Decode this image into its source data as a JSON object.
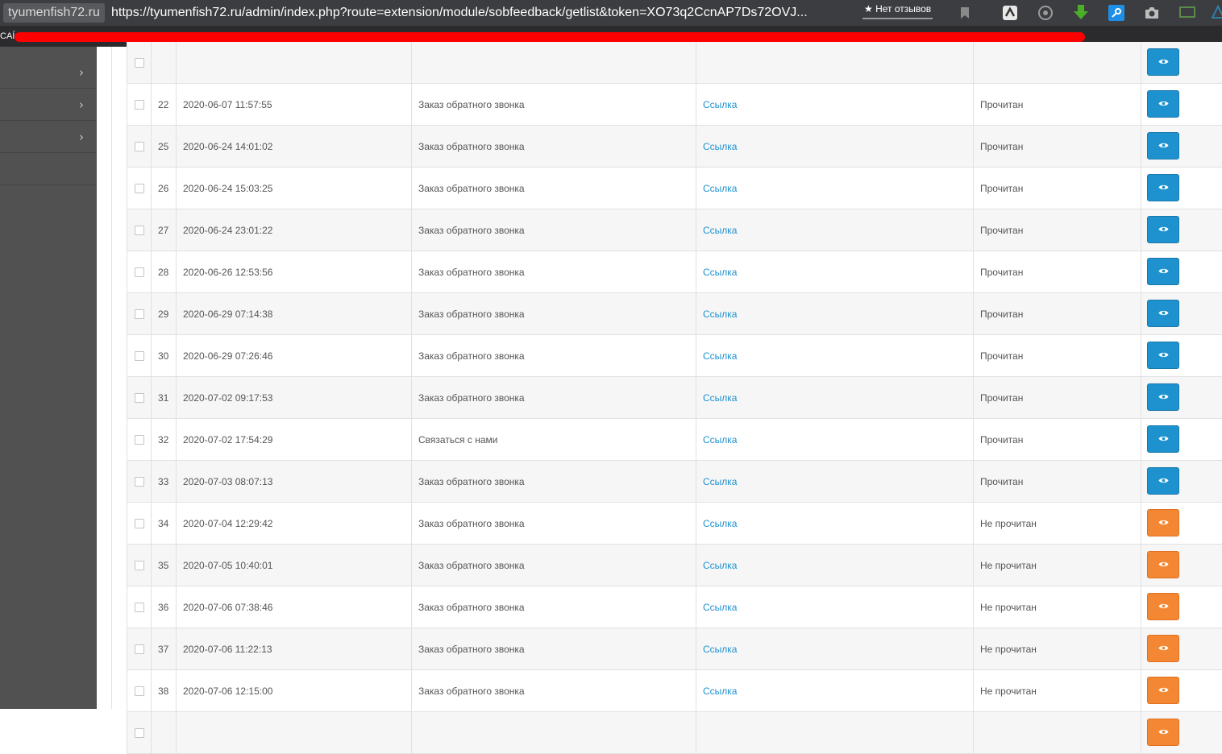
{
  "browser": {
    "domain": "tyumenfish72.ru",
    "url": "https://tyumenfish72.ru/admin/index.php?route=extension/module/sobfeedback/getlist&token=XO73q2CcnAP7Ds72OVJ...",
    "reviews_label": "★ Нет отзывов",
    "bookmarks_label": "CAÍ",
    "toolbar_icons": [
      "bookmark-icon",
      "extension-icon",
      "history-icon",
      "download-icon",
      "key-icon",
      "camera-icon",
      "monitor-icon",
      "shape-icon"
    ]
  },
  "sidebar": {
    "items": [
      {
        "chevron": "›"
      },
      {
        "chevron": "›"
      },
      {
        "chevron": "›"
      },
      {
        "chevron": ""
      }
    ]
  },
  "table": {
    "rows": [
      {
        "id": "",
        "date": "",
        "type": "",
        "link": "",
        "status": "",
        "state": "read"
      },
      {
        "id": "22",
        "date": "2020-06-07 11:57:55",
        "type": "Заказ обратного звонка",
        "link": "Ссылка",
        "status": "Прочитан",
        "state": "read"
      },
      {
        "id": "25",
        "date": "2020-06-24 14:01:02",
        "type": "Заказ обратного звонка",
        "link": "Ссылка",
        "status": "Прочитан",
        "state": "read"
      },
      {
        "id": "26",
        "date": "2020-06-24 15:03:25",
        "type": "Заказ обратного звонка",
        "link": "Ссылка",
        "status": "Прочитан",
        "state": "read"
      },
      {
        "id": "27",
        "date": "2020-06-24 23:01:22",
        "type": "Заказ обратного звонка",
        "link": "Ссылка",
        "status": "Прочитан",
        "state": "read"
      },
      {
        "id": "28",
        "date": "2020-06-26 12:53:56",
        "type": "Заказ обратного звонка",
        "link": "Ссылка",
        "status": "Прочитан",
        "state": "read"
      },
      {
        "id": "29",
        "date": "2020-06-29 07:14:38",
        "type": "Заказ обратного звонка",
        "link": "Ссылка",
        "status": "Прочитан",
        "state": "read"
      },
      {
        "id": "30",
        "date": "2020-06-29 07:26:46",
        "type": "Заказ обратного звонка",
        "link": "Ссылка",
        "status": "Прочитан",
        "state": "read"
      },
      {
        "id": "31",
        "date": "2020-07-02 09:17:53",
        "type": "Заказ обратного звонка",
        "link": "Ссылка",
        "status": "Прочитан",
        "state": "read"
      },
      {
        "id": "32",
        "date": "2020-07-02 17:54:29",
        "type": "Связаться с нами",
        "link": "Ссылка",
        "status": "Прочитан",
        "state": "read"
      },
      {
        "id": "33",
        "date": "2020-07-03 08:07:13",
        "type": "Заказ обратного звонка",
        "link": "Ссылка",
        "status": "Прочитан",
        "state": "read"
      },
      {
        "id": "34",
        "date": "2020-07-04 12:29:42",
        "type": "Заказ обратного звонка",
        "link": "Ссылка",
        "status": "Не прочитан",
        "state": "unread"
      },
      {
        "id": "35",
        "date": "2020-07-05 10:40:01",
        "type": "Заказ обратного звонка",
        "link": "Ссылка",
        "status": "Не прочитан",
        "state": "unread"
      },
      {
        "id": "36",
        "date": "2020-07-06 07:38:46",
        "type": "Заказ обратного звонка",
        "link": "Ссылка",
        "status": "Не прочитан",
        "state": "unread"
      },
      {
        "id": "37",
        "date": "2020-07-06 11:22:13",
        "type": "Заказ обратного звонка",
        "link": "Ссылка",
        "status": "Не прочитан",
        "state": "unread"
      },
      {
        "id": "38",
        "date": "2020-07-06 12:15:00",
        "type": "Заказ обратного звонка",
        "link": "Ссылка",
        "status": "Не прочитан",
        "state": "unread"
      },
      {
        "id": "",
        "date": "",
        "type": "",
        "link": "",
        "status": "",
        "state": "unread"
      }
    ],
    "view_icon": "eye-icon"
  },
  "colors": {
    "read_button": "#1e91cf",
    "unread_button": "#f38733",
    "link": "#1e91cf",
    "sidebar": "#515151",
    "redaction": "#ff0000"
  }
}
